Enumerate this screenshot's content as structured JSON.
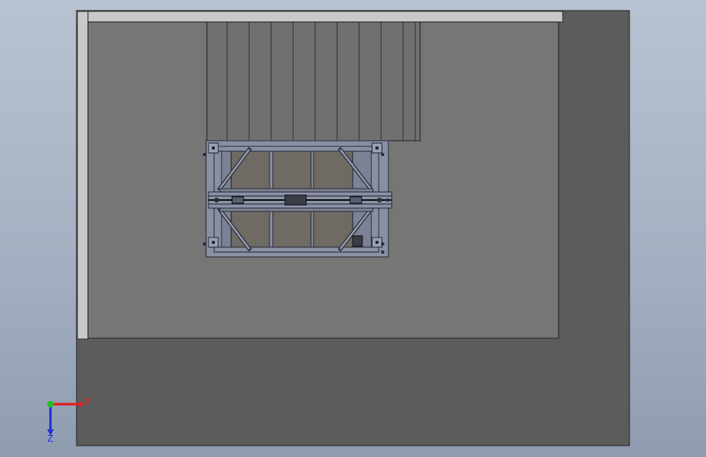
{
  "viewport": {
    "background_top": "#b8c3d2",
    "background_bottom": "#8f9cb0"
  },
  "model": {
    "colors": {
      "outer_slab": "#5c5c5c",
      "inner_floor": "#767676",
      "wall_edge": "#c9c9c9",
      "slats": "#707070",
      "frame": "#8a90a4",
      "frame_dark": "#3a3d48",
      "panel": "#6f6a64"
    }
  },
  "triad": {
    "x_label": "X",
    "z_label": "Z",
    "x_color": "#e02020",
    "y_color": "#20c020",
    "z_color": "#2030d0"
  }
}
